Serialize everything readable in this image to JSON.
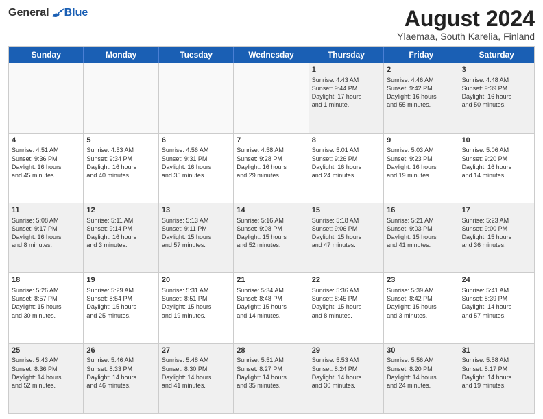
{
  "header": {
    "logo_general": "General",
    "logo_blue": "Blue",
    "title": "August 2024",
    "location": "Ylaemaa, South Karelia, Finland"
  },
  "days_of_week": [
    "Sunday",
    "Monday",
    "Tuesday",
    "Wednesday",
    "Thursday",
    "Friday",
    "Saturday"
  ],
  "weeks": [
    [
      {
        "day": "",
        "lines": [],
        "empty": true
      },
      {
        "day": "",
        "lines": [],
        "empty": true
      },
      {
        "day": "",
        "lines": [],
        "empty": true
      },
      {
        "day": "",
        "lines": [],
        "empty": true
      },
      {
        "day": "1",
        "lines": [
          "Sunrise: 4:43 AM",
          "Sunset: 9:44 PM",
          "Daylight: 17 hours",
          "and 1 minute."
        ],
        "empty": false
      },
      {
        "day": "2",
        "lines": [
          "Sunrise: 4:46 AM",
          "Sunset: 9:42 PM",
          "Daylight: 16 hours",
          "and 55 minutes."
        ],
        "empty": false
      },
      {
        "day": "3",
        "lines": [
          "Sunrise: 4:48 AM",
          "Sunset: 9:39 PM",
          "Daylight: 16 hours",
          "and 50 minutes."
        ],
        "empty": false
      }
    ],
    [
      {
        "day": "4",
        "lines": [
          "Sunrise: 4:51 AM",
          "Sunset: 9:36 PM",
          "Daylight: 16 hours",
          "and 45 minutes."
        ],
        "empty": false
      },
      {
        "day": "5",
        "lines": [
          "Sunrise: 4:53 AM",
          "Sunset: 9:34 PM",
          "Daylight: 16 hours",
          "and 40 minutes."
        ],
        "empty": false
      },
      {
        "day": "6",
        "lines": [
          "Sunrise: 4:56 AM",
          "Sunset: 9:31 PM",
          "Daylight: 16 hours",
          "and 35 minutes."
        ],
        "empty": false
      },
      {
        "day": "7",
        "lines": [
          "Sunrise: 4:58 AM",
          "Sunset: 9:28 PM",
          "Daylight: 16 hours",
          "and 29 minutes."
        ],
        "empty": false
      },
      {
        "day": "8",
        "lines": [
          "Sunrise: 5:01 AM",
          "Sunset: 9:26 PM",
          "Daylight: 16 hours",
          "and 24 minutes."
        ],
        "empty": false
      },
      {
        "day": "9",
        "lines": [
          "Sunrise: 5:03 AM",
          "Sunset: 9:23 PM",
          "Daylight: 16 hours",
          "and 19 minutes."
        ],
        "empty": false
      },
      {
        "day": "10",
        "lines": [
          "Sunrise: 5:06 AM",
          "Sunset: 9:20 PM",
          "Daylight: 16 hours",
          "and 14 minutes."
        ],
        "empty": false
      }
    ],
    [
      {
        "day": "11",
        "lines": [
          "Sunrise: 5:08 AM",
          "Sunset: 9:17 PM",
          "Daylight: 16 hours",
          "and 8 minutes."
        ],
        "empty": false
      },
      {
        "day": "12",
        "lines": [
          "Sunrise: 5:11 AM",
          "Sunset: 9:14 PM",
          "Daylight: 16 hours",
          "and 3 minutes."
        ],
        "empty": false
      },
      {
        "day": "13",
        "lines": [
          "Sunrise: 5:13 AM",
          "Sunset: 9:11 PM",
          "Daylight: 15 hours",
          "and 57 minutes."
        ],
        "empty": false
      },
      {
        "day": "14",
        "lines": [
          "Sunrise: 5:16 AM",
          "Sunset: 9:08 PM",
          "Daylight: 15 hours",
          "and 52 minutes."
        ],
        "empty": false
      },
      {
        "day": "15",
        "lines": [
          "Sunrise: 5:18 AM",
          "Sunset: 9:06 PM",
          "Daylight: 15 hours",
          "and 47 minutes."
        ],
        "empty": false
      },
      {
        "day": "16",
        "lines": [
          "Sunrise: 5:21 AM",
          "Sunset: 9:03 PM",
          "Daylight: 15 hours",
          "and 41 minutes."
        ],
        "empty": false
      },
      {
        "day": "17",
        "lines": [
          "Sunrise: 5:23 AM",
          "Sunset: 9:00 PM",
          "Daylight: 15 hours",
          "and 36 minutes."
        ],
        "empty": false
      }
    ],
    [
      {
        "day": "18",
        "lines": [
          "Sunrise: 5:26 AM",
          "Sunset: 8:57 PM",
          "Daylight: 15 hours",
          "and 30 minutes."
        ],
        "empty": false
      },
      {
        "day": "19",
        "lines": [
          "Sunrise: 5:29 AM",
          "Sunset: 8:54 PM",
          "Daylight: 15 hours",
          "and 25 minutes."
        ],
        "empty": false
      },
      {
        "day": "20",
        "lines": [
          "Sunrise: 5:31 AM",
          "Sunset: 8:51 PM",
          "Daylight: 15 hours",
          "and 19 minutes."
        ],
        "empty": false
      },
      {
        "day": "21",
        "lines": [
          "Sunrise: 5:34 AM",
          "Sunset: 8:48 PM",
          "Daylight: 15 hours",
          "and 14 minutes."
        ],
        "empty": false
      },
      {
        "day": "22",
        "lines": [
          "Sunrise: 5:36 AM",
          "Sunset: 8:45 PM",
          "Daylight: 15 hours",
          "and 8 minutes."
        ],
        "empty": false
      },
      {
        "day": "23",
        "lines": [
          "Sunrise: 5:39 AM",
          "Sunset: 8:42 PM",
          "Daylight: 15 hours",
          "and 3 minutes."
        ],
        "empty": false
      },
      {
        "day": "24",
        "lines": [
          "Sunrise: 5:41 AM",
          "Sunset: 8:39 PM",
          "Daylight: 14 hours",
          "and 57 minutes."
        ],
        "empty": false
      }
    ],
    [
      {
        "day": "25",
        "lines": [
          "Sunrise: 5:43 AM",
          "Sunset: 8:36 PM",
          "Daylight: 14 hours",
          "and 52 minutes."
        ],
        "empty": false
      },
      {
        "day": "26",
        "lines": [
          "Sunrise: 5:46 AM",
          "Sunset: 8:33 PM",
          "Daylight: 14 hours",
          "and 46 minutes."
        ],
        "empty": false
      },
      {
        "day": "27",
        "lines": [
          "Sunrise: 5:48 AM",
          "Sunset: 8:30 PM",
          "Daylight: 14 hours",
          "and 41 minutes."
        ],
        "empty": false
      },
      {
        "day": "28",
        "lines": [
          "Sunrise: 5:51 AM",
          "Sunset: 8:27 PM",
          "Daylight: 14 hours",
          "and 35 minutes."
        ],
        "empty": false
      },
      {
        "day": "29",
        "lines": [
          "Sunrise: 5:53 AM",
          "Sunset: 8:24 PM",
          "Daylight: 14 hours",
          "and 30 minutes."
        ],
        "empty": false
      },
      {
        "day": "30",
        "lines": [
          "Sunrise: 5:56 AM",
          "Sunset: 8:20 PM",
          "Daylight: 14 hours",
          "and 24 minutes."
        ],
        "empty": false
      },
      {
        "day": "31",
        "lines": [
          "Sunrise: 5:58 AM",
          "Sunset: 8:17 PM",
          "Daylight: 14 hours",
          "and 19 minutes."
        ],
        "empty": false
      }
    ]
  ]
}
